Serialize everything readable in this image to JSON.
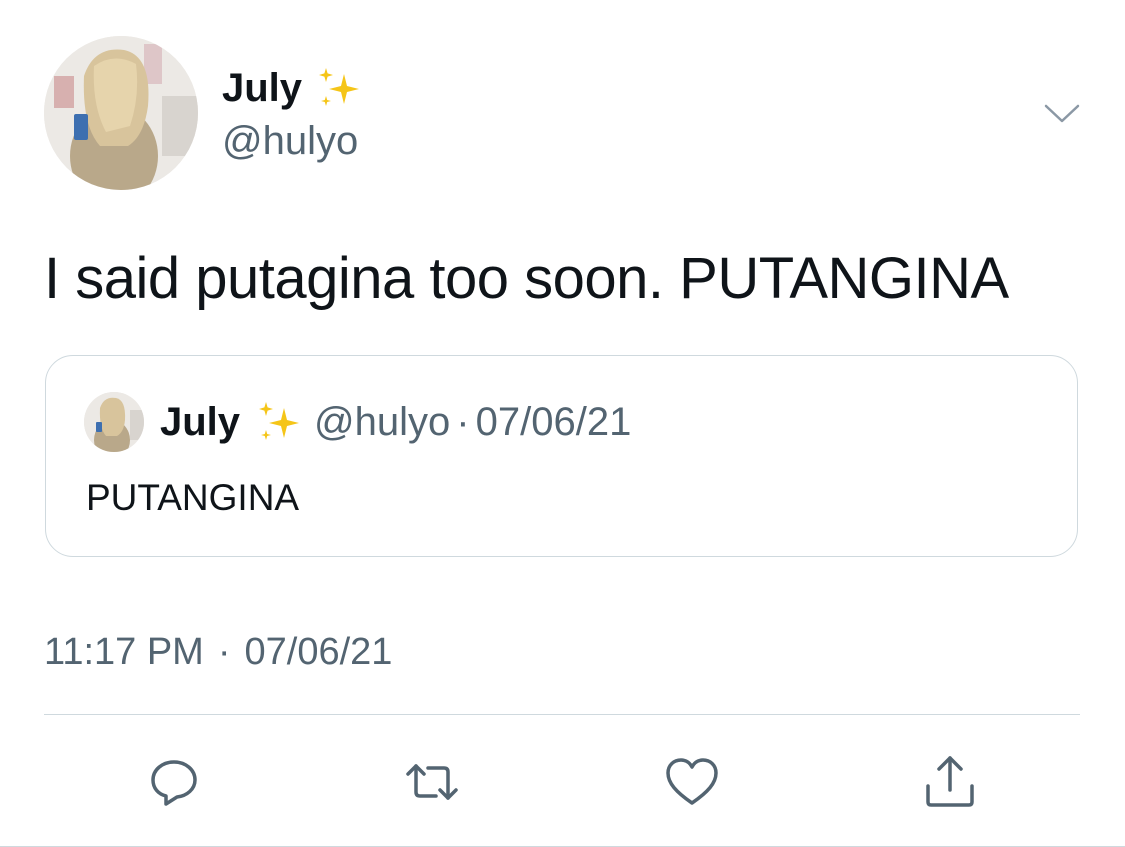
{
  "author": {
    "display_name": "July",
    "handle": "@hulyo",
    "avatar_icon": "profile-photo"
  },
  "tweet": {
    "text": "I said putagina too soon. PUTANGINA"
  },
  "quoted_tweet": {
    "display_name": "July",
    "handle": "@hulyo",
    "separator": "·",
    "date": "07/06/21",
    "text": "PUTANGINA"
  },
  "timestamp": {
    "time": "11:17 PM",
    "separator": "·",
    "date": "07/06/21"
  },
  "icons": {
    "name_emoji": "sparkles-icon",
    "more": "chevron-down-icon",
    "reply": "reply-icon",
    "retweet": "retweet-icon",
    "like": "heart-icon",
    "share": "share-icon"
  },
  "colors": {
    "text_primary": "#0f1419",
    "text_secondary": "#536471",
    "border": "#cfd9de",
    "sparkle": "#f5c518"
  }
}
